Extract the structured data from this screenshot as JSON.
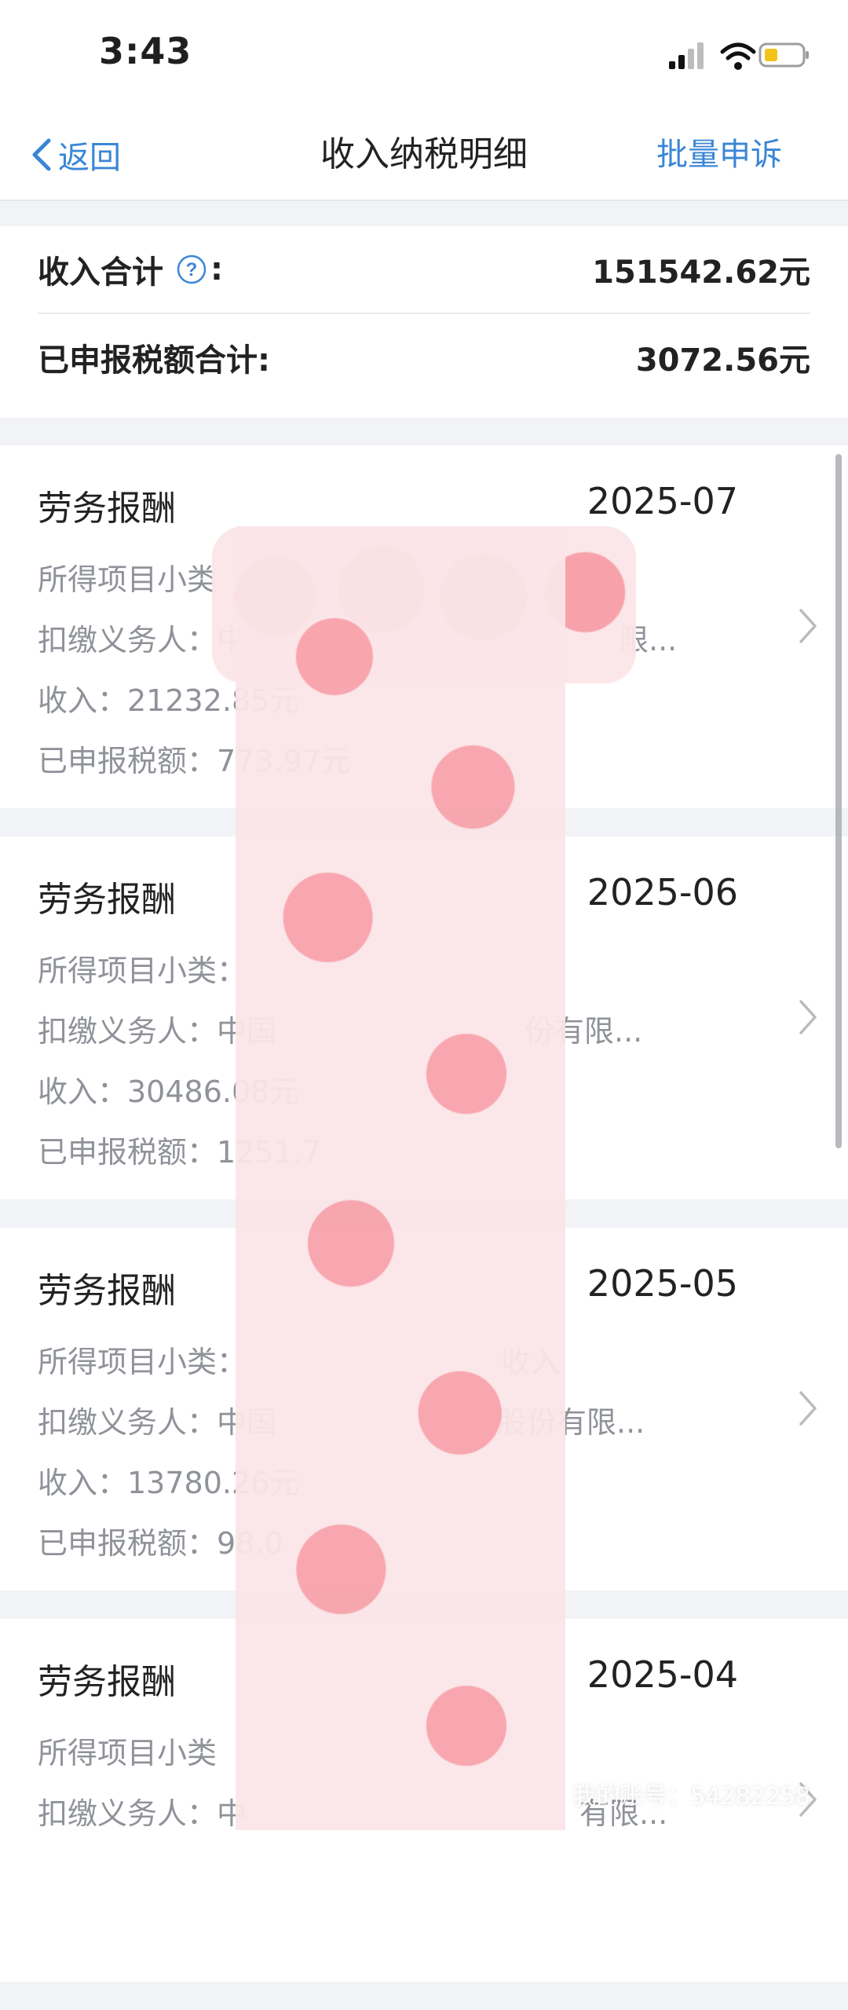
{
  "status": {
    "time": "3:43"
  },
  "nav": {
    "back_label": "返回",
    "title": "收入纳税明细",
    "action_label": "批量申诉"
  },
  "summary": {
    "income_label": "收入合计",
    "income_colon": ":",
    "income_value": "151542.62元",
    "tax_label": "已申报税额合计:",
    "tax_value": "3072.56元"
  },
  "records": [
    {
      "type": "劳务报酬",
      "date": "2025-07",
      "subcategory": "所得项目小类",
      "withholder": "扣缴义务人：中国",
      "withholder_tail": "限...",
      "income": "收入：21232.85元",
      "tax": "已申报税额：773.97元"
    },
    {
      "type": "劳务报酬",
      "date": "2025-06",
      "subcategory": "所得项目小类：",
      "withholder": "扣缴义务人：中国",
      "withholder_tail": "份有限...",
      "income": "收入：30486.08元",
      "tax": "已申报税额：1251.7"
    },
    {
      "type": "劳务报酬",
      "date": "2025-05",
      "subcategory": "所得项目小类：",
      "subcategory_tail": "收入",
      "withholder": "扣缴义务人：中国",
      "withholder_tail": "股份有限...",
      "income": "收入：13780.26元",
      "tax": "已申报税额：98.0"
    },
    {
      "type": "劳务报酬",
      "date": "2025-04",
      "subcategory": "所得项目小类",
      "withholder": "扣缴义务人：中",
      "withholder_tail": "有限..."
    }
  ],
  "watermark": "我的账号：54282258",
  "colors": {
    "accent": "#3a86d6",
    "background": "#f2f3f7",
    "muted_text": "#8f9299"
  }
}
